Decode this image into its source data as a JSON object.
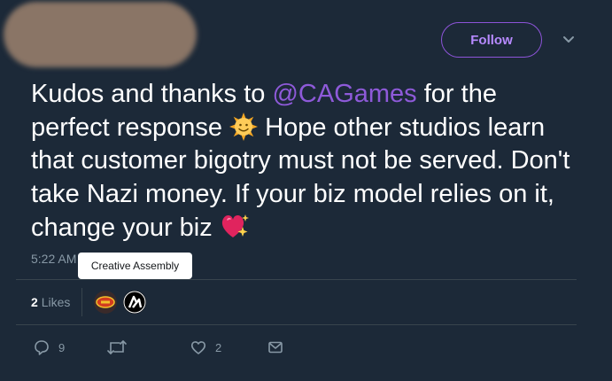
{
  "header": {
    "follow_label": "Follow"
  },
  "tweet": {
    "text_line1_pre": "Kudos and thanks to ",
    "mention": "@CAGames",
    "text_line1_post": " for the",
    "text_part2": "perfect response",
    "text_part3": " Hope other studios learn that customer bigotry must not be served. Don't take Nazi money. If your biz model relies on it, change your biz",
    "emoji_1": "sun-with-face-emoji",
    "emoji_2": "sparkling-heart-emoji",
    "timestamp": "5:22 AM"
  },
  "tooltip": {
    "text": "Creative Assembly"
  },
  "engagement": {
    "likes_count": "2",
    "likes_label": "Likes"
  },
  "actions": {
    "reply_count": "9",
    "retweet_count": "",
    "like_count": "2"
  },
  "colors": {
    "background": "#1c2938",
    "accent": "#8e5ad9",
    "muted": "#8899a6"
  }
}
